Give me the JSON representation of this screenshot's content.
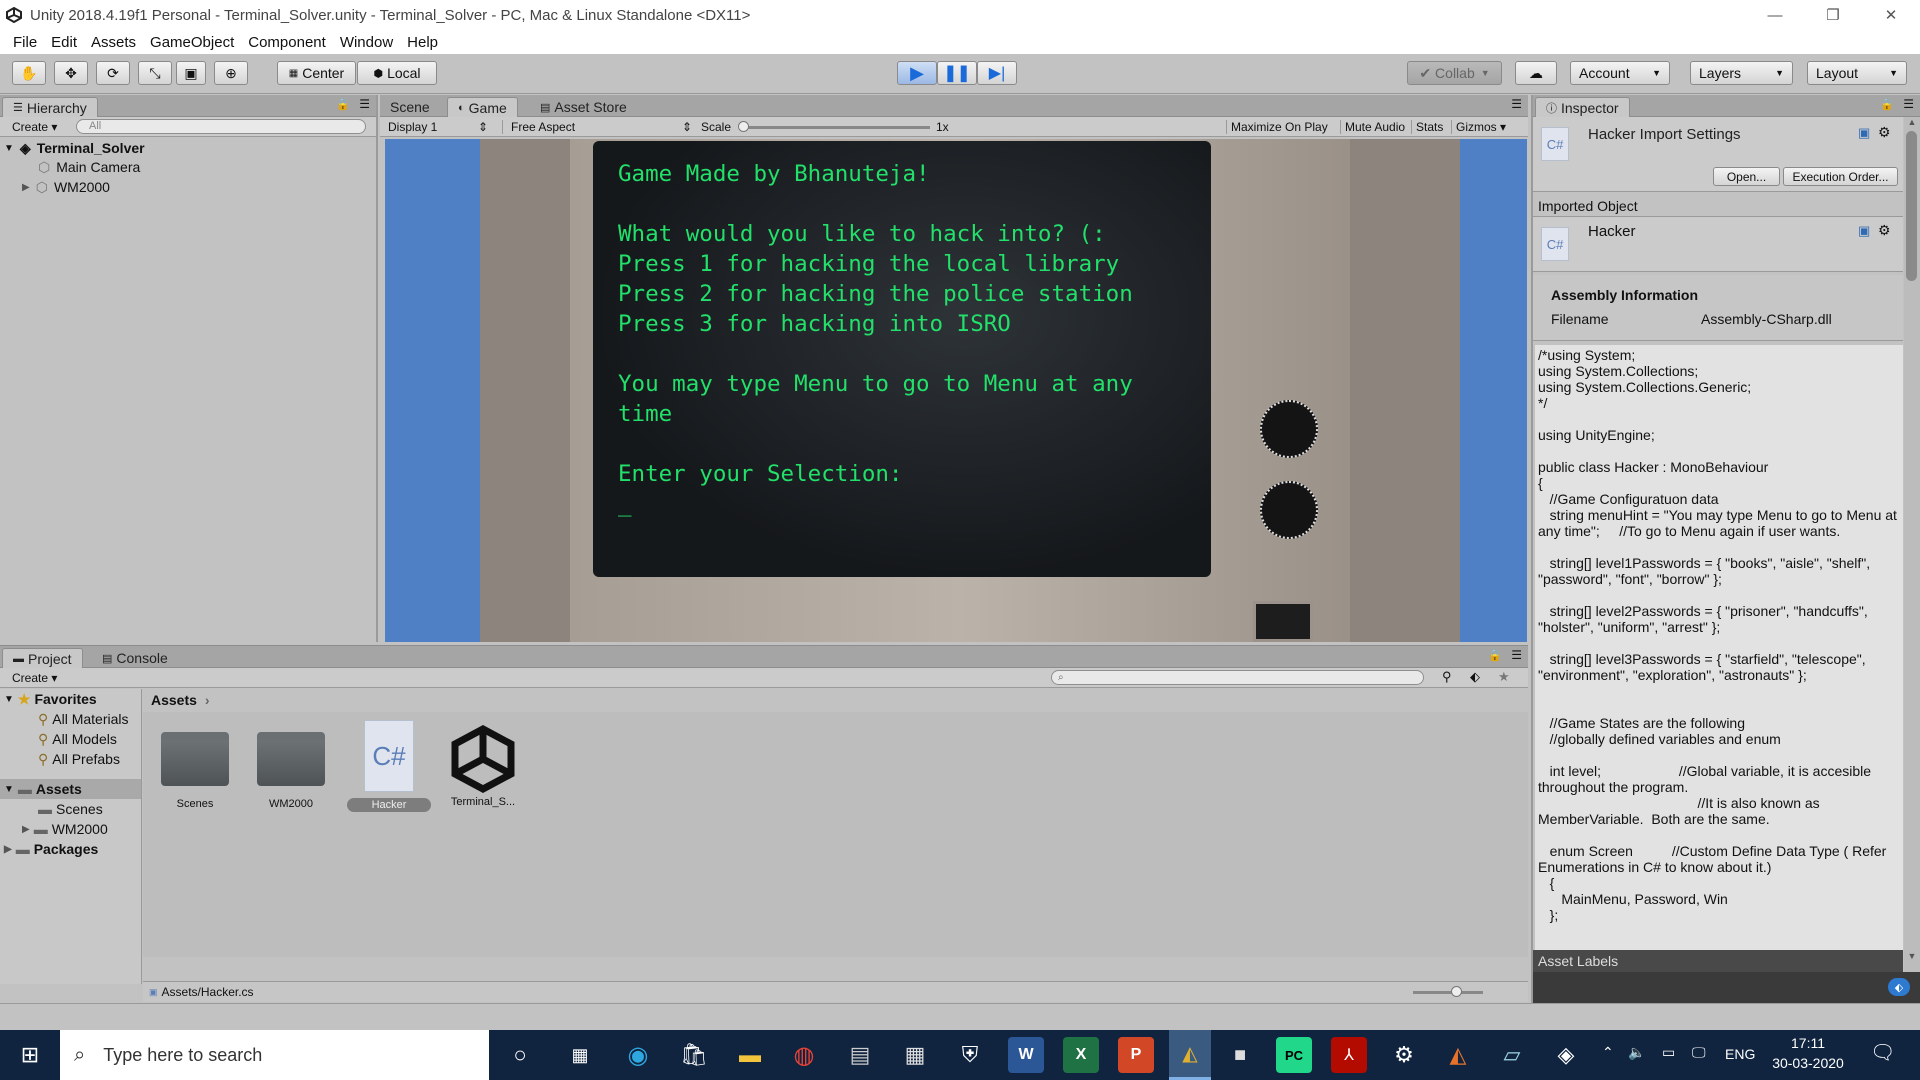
{
  "window": {
    "title": "Unity 2018.4.19f1 Personal - Terminal_Solver.unity - Terminal_Solver - PC, Mac & Linux Standalone <DX11>"
  },
  "menu": [
    "File",
    "Edit",
    "Assets",
    "GameObject",
    "Component",
    "Window",
    "Help"
  ],
  "toolbar": {
    "center_label": "Center",
    "local_label": "Local",
    "collab_label": "Collab",
    "account_label": "Account",
    "layers_label": "Layers",
    "layout_label": "Layout"
  },
  "hierarchy": {
    "tab": "Hierarchy",
    "create": "Create",
    "search_placeholder": "All",
    "scene_name": "Terminal_Solver",
    "items": [
      "Main Camera",
      "WM2000"
    ]
  },
  "game_view": {
    "tabs": [
      "Scene",
      "Game",
      "Asset Store"
    ],
    "display": "Display 1",
    "aspect": "Free Aspect",
    "scale_label": "Scale",
    "scale_value": "1x",
    "options": [
      "Maximize On Play",
      "Mute Audio",
      "Stats",
      "Gizmos"
    ],
    "terminal_lines": [
      "Game Made by Bhanuteja!",
      "",
      "What would you like to hack into? (:",
      "Press 1 for hacking the local library",
      "Press 2 for hacking the police station",
      "Press 3 for hacking into ISRO",
      "",
      "You may type Menu to go to Menu at any",
      "time",
      "",
      "Enter your Selection:",
      "_"
    ]
  },
  "project": {
    "tabs": [
      "Project",
      "Console"
    ],
    "create": "Create",
    "favorites_label": "Favorites",
    "favorites": [
      "All Materials",
      "All Models",
      "All Prefabs"
    ],
    "assets_label": "Assets",
    "asset_folders": [
      "Scenes",
      "WM2000"
    ],
    "packages_label": "Packages",
    "breadcrumb": "Assets",
    "grid_items": [
      "Scenes",
      "WM2000",
      "Hacker",
      "Terminal_S..."
    ],
    "status_path": "Assets/Hacker.cs"
  },
  "inspector": {
    "tab": "Inspector",
    "title": "Hacker Import Settings",
    "open_button": "Open...",
    "exec_button": "Execution Order...",
    "imported_object": "Imported Object",
    "object_name": "Hacker",
    "assembly_header": "Assembly Information",
    "filename_label": "Filename",
    "filename_value": "Assembly-CSharp.dll",
    "code": "/*using System;\nusing System.Collections;\nusing System.Collections.Generic;\n*/\n\nusing UnityEngine;\n\npublic class Hacker : MonoBehaviour\n{\n   //Game Configuratuon data\n   string menuHint = \"You may type Menu to go to Menu at any time\";     //To go to Menu again if user wants.\n\n   string[] level1Passwords = { \"books\", \"aisle\", \"shelf\", \"password\", \"font\", \"borrow\" };\n\n   string[] level2Passwords = { \"prisoner\", \"handcuffs\", \"holster\", \"uniform\", \"arrest\" };\n\n   string[] level3Passwords = { \"starfield\", \"telescope\", \"environment\", \"exploration\", \"astronauts\" };\n\n\n   //Game States are the following\n   //globally defined variables and enum\n\n   int level;                    //Global variable, it is accesible throughout the program.\n                                         //It is also known as MemberVariable.  Both are the same.\n\n   enum Screen          //Custom Define Data Type ( Refer Enumerations in C# to know about it.)\n   {\n      MainMenu, Password, Win\n   };",
    "asset_labels": "Asset Labels"
  },
  "taskbar": {
    "search_placeholder": "Type here to search",
    "lang": "ENG",
    "time": "17:11",
    "date": "30-03-2020"
  }
}
